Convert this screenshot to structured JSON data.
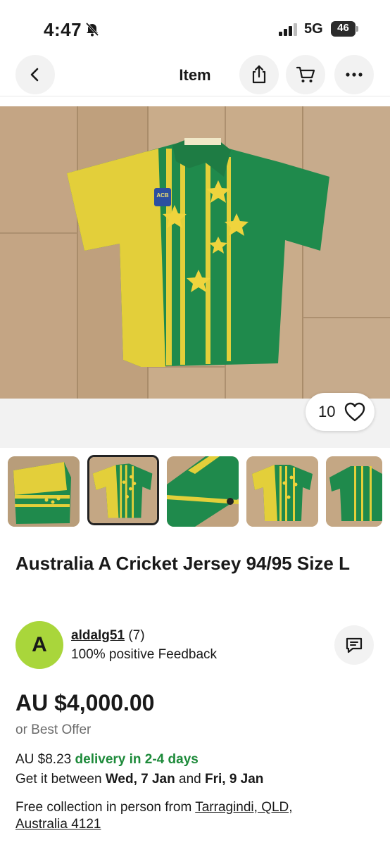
{
  "status_bar": {
    "time": "4:47",
    "network": "5G",
    "battery": "46"
  },
  "header": {
    "title": "Item"
  },
  "hero": {
    "watch_count": "10"
  },
  "listing": {
    "title": "Australia A Cricket Jersey 94/95 Size L",
    "crest_text": "ACB"
  },
  "seller": {
    "avatar_letter": "A",
    "name": "aldalg51",
    "score": "(7)",
    "feedback": "100% positive Feedback"
  },
  "pricing": {
    "price": "AU $4,000.00",
    "best_offer": "or Best Offer",
    "delivery_cost": "AU $8.23",
    "delivery_time": "delivery in 2-4 days",
    "get_it_prefix": "Get it between",
    "date_from": "Wed, 7 Jan",
    "and": "and",
    "date_to": "Fri, 9 Jan",
    "collection_prefix": "Free collection in person from",
    "collection_location": "Tarragindi, QLD, Australia 4121"
  },
  "colors": {
    "jersey_green": "#1f8a4c",
    "jersey_gold": "#e3cf3a",
    "avatar": "#a9d63b",
    "delivery_green": "#1d8a3a"
  },
  "icons": [
    "bell-off-icon",
    "signal-icon",
    "back-arrow-icon",
    "share-icon",
    "cart-icon",
    "more-icon",
    "heart-icon",
    "message-icon"
  ]
}
